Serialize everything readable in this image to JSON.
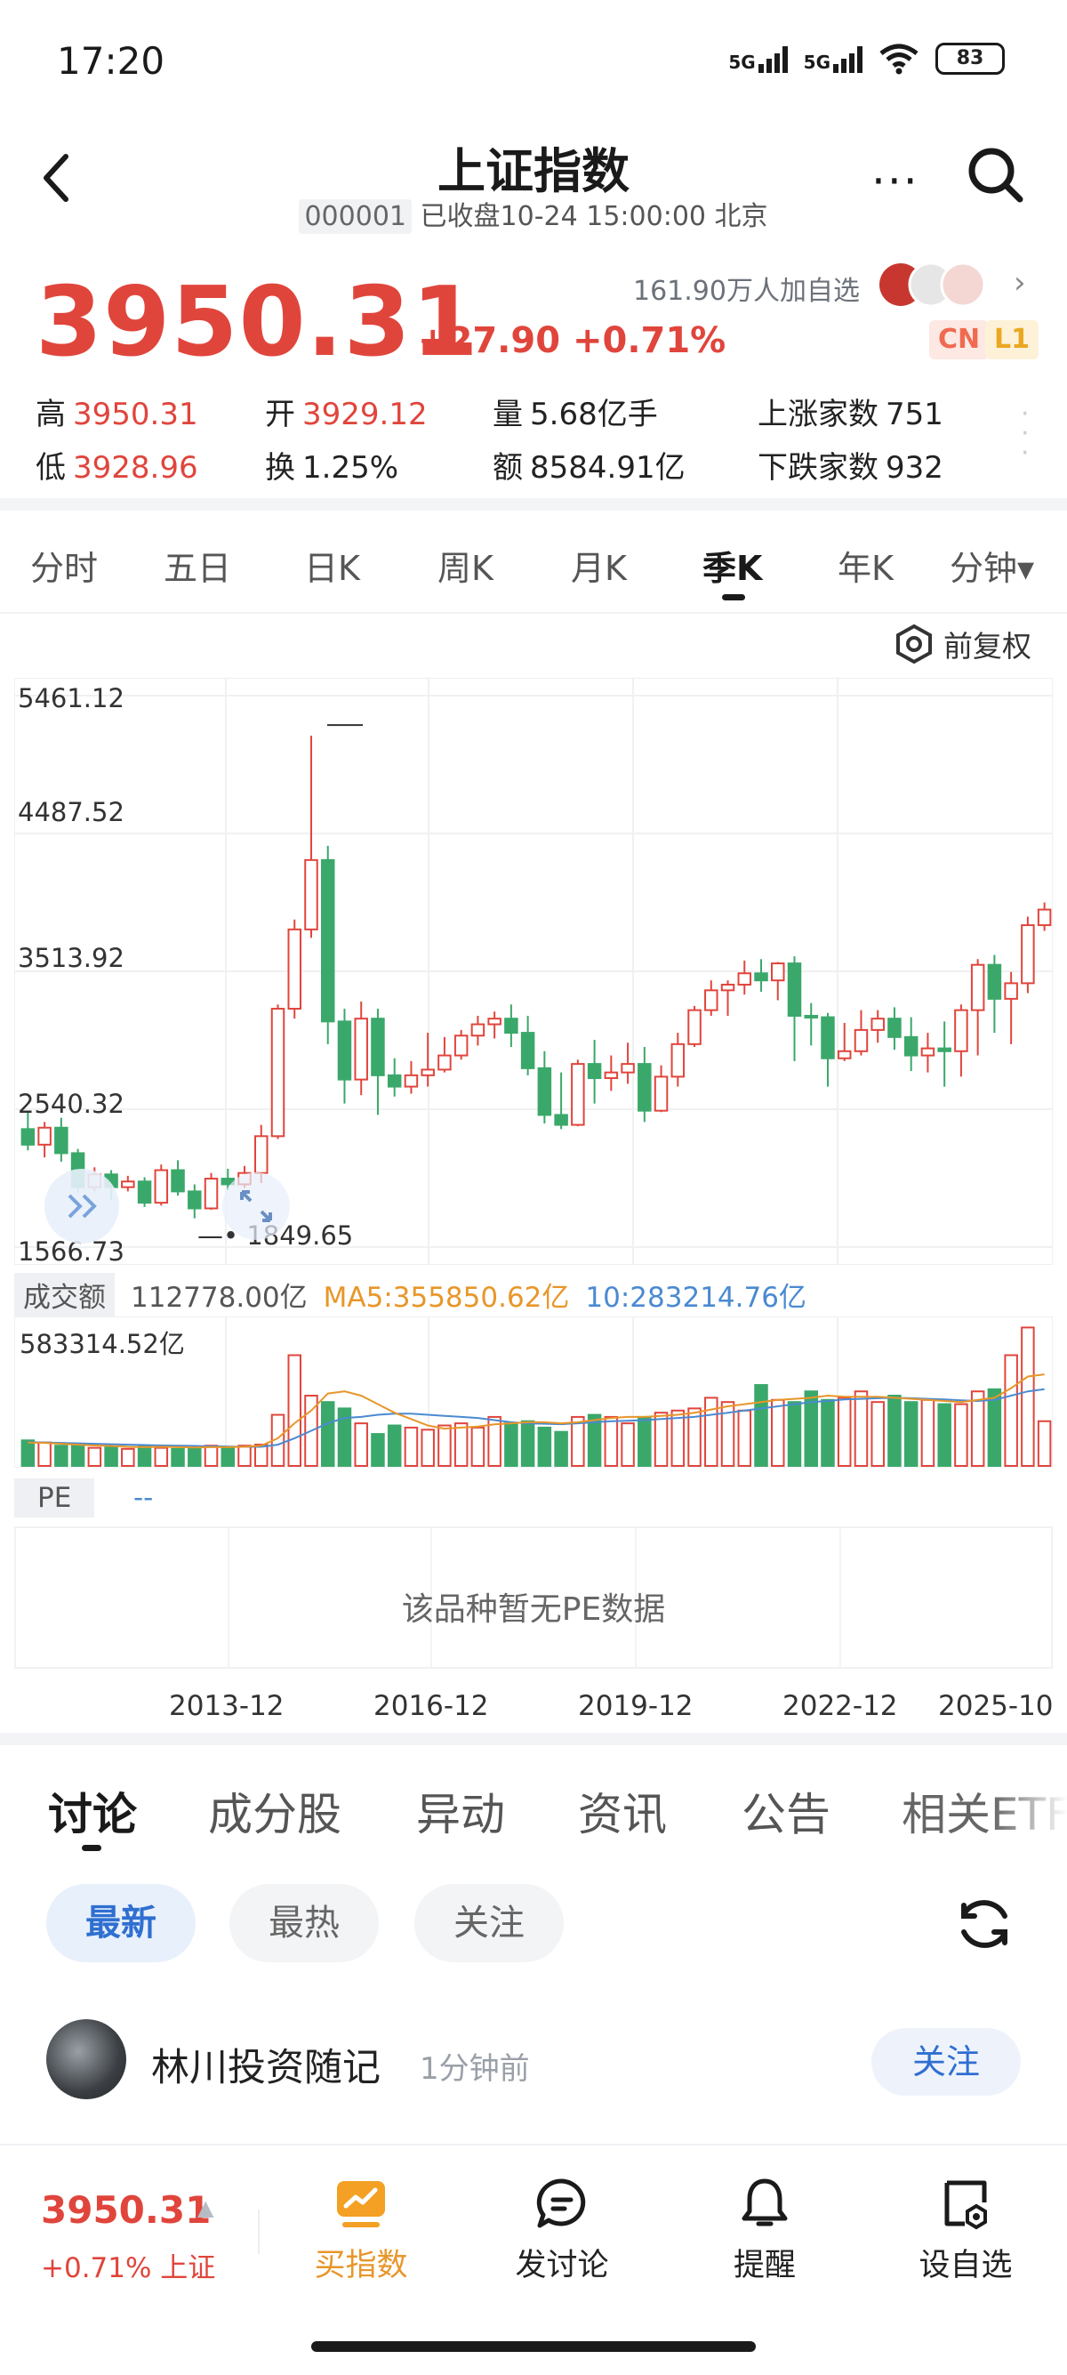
{
  "status_bar": {
    "time": "17:20",
    "net1": "5G",
    "net2": "5G",
    "battery": "83"
  },
  "header": {
    "title": "上证指数",
    "code": "000001",
    "status": "已收盘10-24 15:00:00 北京",
    "more": "···"
  },
  "quote": {
    "price": "3950.31",
    "change": "+27.90 +0.71%",
    "watchers": "161.90万人加自选",
    "tag_cn": "CN",
    "tag_l1": "L1",
    "high_label": "高",
    "high": "3950.31",
    "low_label": "低",
    "low": "3928.96",
    "open_label": "开",
    "open": "3929.12",
    "turnover_label": "换",
    "turnover": "1.25%",
    "volume_label": "量",
    "volume": "5.68亿手",
    "amount_label": "额",
    "amount": "8584.91亿",
    "up_label": "上涨家数",
    "up": "751",
    "down_label": "下跌家数",
    "down": "932"
  },
  "period_tabs": [
    "分时",
    "五日",
    "日K",
    "周K",
    "月K",
    "季K",
    "年K",
    "分钟▾"
  ],
  "active_period": "季K",
  "adjust_label": "前复权",
  "chart_data": {
    "type": "candlestick",
    "y_ticks": [
      "5461.12",
      "4487.52",
      "3513.92",
      "2540.32",
      "1566.73"
    ],
    "ylim": [
      1566.73,
      5461.12
    ],
    "low_marker": "1849.65",
    "x_ticks": [
      "2013-12",
      "2016-12",
      "2019-12",
      "2022-12",
      "2025-10"
    ],
    "colors": {
      "up": "#e0453c",
      "down": "#3aa86a"
    },
    "candles": [
      [
        2400,
        2290,
        2520,
        2250
      ],
      [
        2290,
        2410,
        2450,
        2200
      ],
      [
        2410,
        2230,
        2480,
        2170
      ],
      [
        2230,
        1990,
        2260,
        1950
      ],
      [
        1990,
        2080,
        2130,
        1960
      ],
      [
        2080,
        1990,
        2110,
        1900
      ],
      [
        1990,
        2030,
        2070,
        1960
      ],
      [
        2030,
        1880,
        2060,
        1850
      ],
      [
        1880,
        2110,
        2150,
        1860
      ],
      [
        2110,
        1960,
        2180,
        1930
      ],
      [
        1960,
        1840,
        2010,
        1770
      ],
      [
        1840,
        2050,
        2090,
        1830
      ],
      [
        2050,
        2010,
        2120,
        1970
      ],
      [
        2010,
        2090,
        2140,
        1985
      ],
      [
        2090,
        2350,
        2430,
        2020
      ],
      [
        2350,
        3250,
        3280,
        2330
      ],
      [
        3250,
        3810,
        3880,
        3180
      ],
      [
        3810,
        4300,
        5178,
        3750
      ],
      [
        4300,
        3160,
        4400,
        3000
      ],
      [
        3160,
        2750,
        3250,
        2580
      ],
      [
        2750,
        3180,
        3300,
        2640
      ],
      [
        3180,
        2780,
        3250,
        2500
      ],
      [
        2780,
        2700,
        2900,
        2630
      ],
      [
        2700,
        2780,
        2880,
        2650
      ],
      [
        2780,
        2820,
        3080,
        2700
      ],
      [
        2820,
        2920,
        3050,
        2800
      ],
      [
        2920,
        3060,
        3100,
        2890
      ],
      [
        3060,
        3140,
        3200,
        2990
      ],
      [
        3140,
        3180,
        3230,
        3040
      ],
      [
        3180,
        3080,
        3280,
        2980
      ],
      [
        3080,
        2830,
        3200,
        2780
      ],
      [
        2830,
        2500,
        2950,
        2440
      ],
      [
        2500,
        2430,
        2800,
        2400
      ],
      [
        2430,
        2860,
        2890,
        2420
      ],
      [
        2860,
        2760,
        3030,
        2580
      ],
      [
        2760,
        2800,
        2920,
        2670
      ],
      [
        2800,
        2860,
        3010,
        2720
      ],
      [
        2860,
        2530,
        2980,
        2450
      ],
      [
        2530,
        2770,
        2850,
        2520
      ],
      [
        2770,
        3000,
        3080,
        2700
      ],
      [
        3000,
        3240,
        3270,
        2980
      ],
      [
        3240,
        3380,
        3450,
        3200
      ],
      [
        3380,
        3420,
        3450,
        3200
      ],
      [
        3420,
        3500,
        3590,
        3350
      ],
      [
        3500,
        3450,
        3600,
        3370
      ],
      [
        3450,
        3570,
        3580,
        3310
      ],
      [
        3570,
        3200,
        3620,
        2880
      ],
      [
        3200,
        3190,
        3290,
        2990
      ],
      [
        3190,
        2900,
        3220,
        2700
      ],
      [
        2900,
        2950,
        3150,
        2880
      ],
      [
        2950,
        3100,
        3240,
        2920
      ],
      [
        3100,
        3180,
        3240,
        3010
      ],
      [
        3180,
        3050,
        3260,
        2960
      ],
      [
        3050,
        2920,
        3190,
        2810
      ],
      [
        2920,
        2970,
        3080,
        2800
      ],
      [
        2970,
        2950,
        3160,
        2700
      ],
      [
        2950,
        3240,
        3280,
        2770
      ],
      [
        3240,
        3560,
        3600,
        2920
      ],
      [
        3560,
        3320,
        3630,
        3080
      ],
      [
        3320,
        3430,
        3510,
        3000
      ],
      [
        3430,
        3840,
        3900,
        3360
      ],
      [
        3840,
        3950,
        4000,
        3800
      ]
    ],
    "turnover_label": "成交额",
    "turnover_value": "112778.00亿",
    "ma5_label": "MA5:355850.62亿",
    "ma10_label": "10:283214.76亿",
    "vol_max_label": "583314.52亿",
    "volumes": [
      120,
      110,
      95,
      100,
      85,
      90,
      80,
      95,
      85,
      80,
      85,
      95,
      90,
      95,
      100,
      240,
      520,
      330,
      300,
      270,
      200,
      150,
      190,
      180,
      170,
      190,
      200,
      180,
      230,
      200,
      210,
      180,
      160,
      230,
      240,
      230,
      200,
      230,
      250,
      260,
      270,
      320,
      300,
      260,
      380,
      310,
      300,
      350,
      310,
      320,
      350,
      300,
      330,
      300,
      310,
      290,
      290,
      350,
      360,
      520,
      650,
      210
    ],
    "ma5": [
      110,
      108,
      104,
      100,
      96,
      94,
      90,
      88,
      90,
      88,
      87,
      88,
      88,
      90,
      95,
      130,
      200,
      260,
      340,
      350,
      330,
      290,
      250,
      220,
      190,
      175,
      180,
      185,
      195,
      200,
      205,
      205,
      200,
      205,
      215,
      225,
      230,
      230,
      235,
      240,
      250,
      265,
      280,
      290,
      300,
      310,
      315,
      320,
      330,
      325,
      325,
      325,
      320,
      315,
      310,
      305,
      300,
      310,
      320,
      365,
      420,
      430
    ],
    "ma10": [
      112,
      110,
      108,
      106,
      104,
      102,
      100,
      98,
      96,
      95,
      94,
      92,
      91,
      90,
      90,
      100,
      130,
      165,
      200,
      225,
      230,
      240,
      245,
      245,
      240,
      235,
      230,
      225,
      215,
      205,
      200,
      198,
      196,
      200,
      205,
      210,
      212,
      215,
      220,
      225,
      230,
      240,
      250,
      260,
      270,
      280,
      290,
      300,
      305,
      312,
      315,
      318,
      320,
      318,
      315,
      312,
      308,
      305,
      310,
      330,
      350,
      360
    ]
  },
  "pe": {
    "label": "PE",
    "value": "--",
    "empty_msg": "该品种暂无PE数据"
  },
  "discussion_tabs": [
    "讨论",
    "成分股",
    "异动",
    "资讯",
    "公告",
    "相关ETF"
  ],
  "filter_pills": [
    "最新",
    "最热",
    "关注"
  ],
  "post": {
    "author": "林川投资随记",
    "time": "1分钟前",
    "follow": "关注"
  },
  "bottom_bar": {
    "price": "3950.31",
    "sub": "+0.71% 上证",
    "items": [
      "买指数",
      "发讨论",
      "提醒",
      "设自选"
    ]
  }
}
